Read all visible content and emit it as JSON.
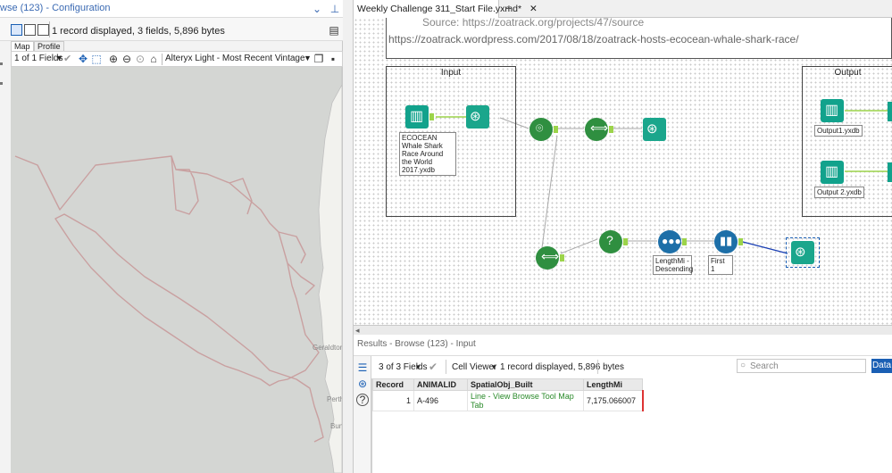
{
  "left_pane": {
    "title": "wse (123) - Configuration",
    "status": "1 record displayed, 3 fields, 5,896 bytes",
    "tabs": [
      "Map",
      "Profile"
    ],
    "fields_select": "1 of 1 Fields",
    "base_map_select": "Alteryx Light - Most Recent Vintage",
    "map_labels": [
      "Geraldton",
      "Perth",
      "Bunb"
    ]
  },
  "canvas": {
    "doc_tab": "Weekly Challenge 311_Start File.yxmd*",
    "comment_line1": "Source: https://zoatrack.org/projects/47/source",
    "comment_line2": "https://zoatrack.wordpress.com/2017/08/18/zoatrack-hosts-ecocean-whale-shark-race/",
    "input_container": "Input",
    "output_container": "Output",
    "input_label": "ECOCEAN Whale Shark Race Around the World 2017.yxdb",
    "output1_label": "Output1.yxdb",
    "output2_label": "Output 2.yxdb",
    "sort_label": "LengthMi - Descending",
    "sample_label": "First 1"
  },
  "results": {
    "title": "Results - Browse (123) - Input",
    "fields": "3 of 3 Fields",
    "cell_viewer": "Cell Viewer",
    "status": "1 record displayed, 5,896 bytes",
    "search_placeholder": "Search",
    "data_button": "Data",
    "columns": [
      "Record",
      "ANIMALID",
      "SpatialObj_Built",
      "LengthMi"
    ],
    "rows": [
      [
        "1",
        "A-496",
        "Line - View Browse Tool Map Tab",
        "7,175.066007"
      ]
    ]
  },
  "colors": {
    "accent": "#1a5fb4",
    "tool_green": "#2f8f40",
    "tool_teal": "#12a28c",
    "tool_blue": "#1d6fa8",
    "track": "#c9a0a0"
  }
}
